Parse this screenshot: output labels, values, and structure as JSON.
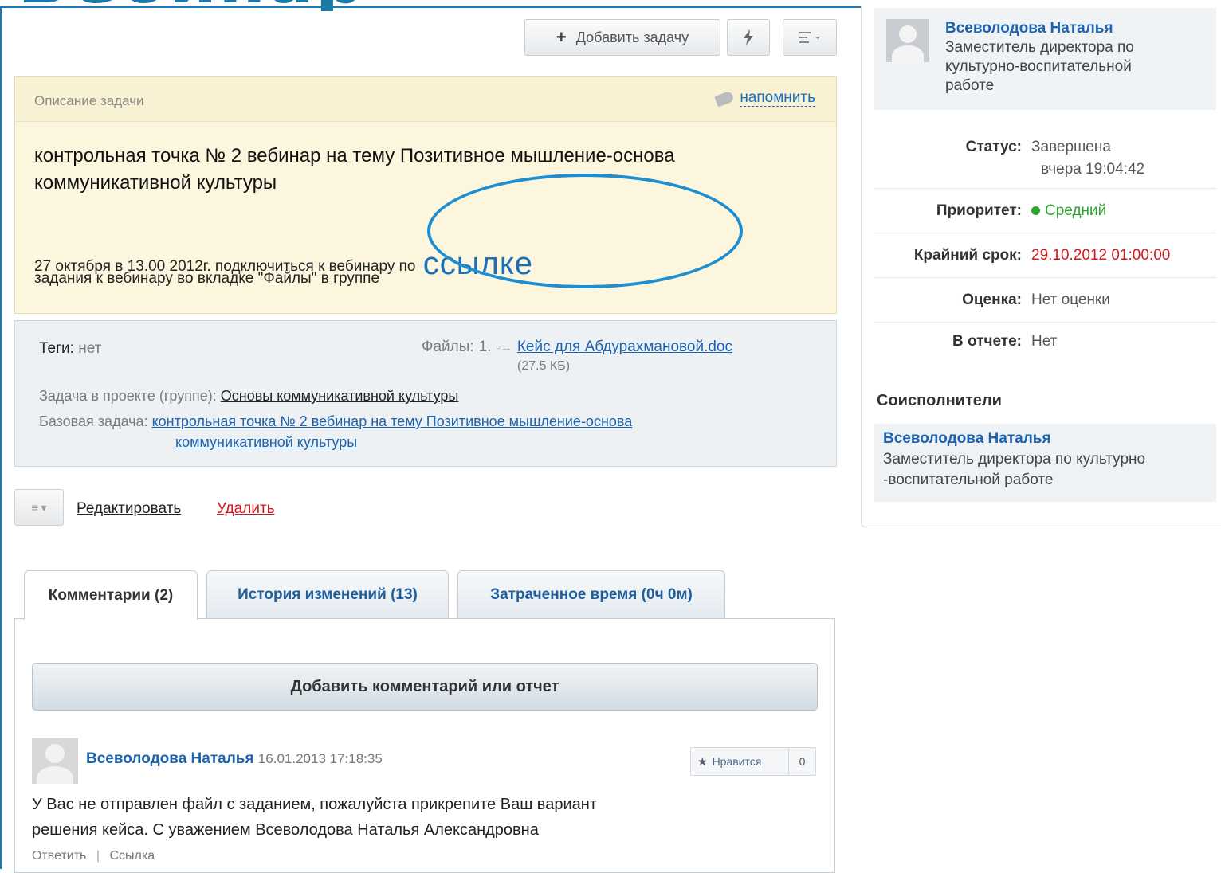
{
  "slide": {
    "title": "Вебинар"
  },
  "toolbar": {
    "add_task_label": "Добавить задачу",
    "add_task_icon": "plus-icon",
    "bolt_icon": "lightning-icon",
    "menu_icon": "list-menu-icon"
  },
  "description": {
    "label": "Описание задачи",
    "remind_label": "напомнить",
    "title": "контрольная точка № 2 вебинар на тему Позитивное мышление-основа коммуникативной культуры",
    "body_line1": "27 октября в 13.00 2012г. подключиться к вебинару по",
    "body_link": "ссылке",
    "body_line2": "задания к вебинару во вкладке \"Файлы\" в группе"
  },
  "meta": {
    "tags_label": "Теги:",
    "tags_value": "нет",
    "files_label": "Файлы:",
    "files_count": "1.",
    "file_name": "Кейс для Абдурахмановой.doc",
    "file_size": "(27.5 КБ)",
    "project_label": "Задача в проекте (группе):",
    "project_value": "Основы коммуникативной культуры",
    "base_task_label": "Базовая задача:",
    "base_task_line1": "контрольная точка № 2 вебинар на тему Позитивное мышление-основа",
    "base_task_line2": "коммуникативной культуры"
  },
  "actions": {
    "edit_label": "Редактировать",
    "delete_label": "Удалить"
  },
  "tabs": [
    {
      "label": "Комментарии (2)"
    },
    {
      "label": "История изменений (13)"
    },
    {
      "label": "Затраченное время (0ч 0м)"
    }
  ],
  "comments": {
    "add_label": "Добавить комментарий или отчет",
    "items": [
      {
        "author": "Всеволодова Наталья",
        "date": "16.01.2013 17:18:35",
        "like_label": "Нравится",
        "like_count": "0",
        "text_line1": "У Вас не отправлен файл с заданием, пожалуйста прикрепите Ваш вариант",
        "text_line2": "решения кейса. С уважением Всеволодова Наталья Александровна",
        "reply_label": "Ответить",
        "separator": "|",
        "link_label": "Ссылка"
      }
    ]
  },
  "sidebar": {
    "owner_name": "Всеволодова Наталья",
    "owner_role_line1": "Заместитель директора по",
    "owner_role_line2": "культурно-воспитательной",
    "owner_role_line3": "работе",
    "status_label": "Статус:",
    "status_value": "Завершена",
    "status_time": "вчера 19:04:42",
    "priority_label": "Приоритет:",
    "priority_value": "Средний",
    "priority_color": "#2fa52f",
    "deadline_label": "Крайний срок:",
    "deadline_value": "29.10.2012 01:00:00",
    "deadline_color": "#d0191c",
    "rating_label": "Оценка:",
    "rating_value": "Нет оценки",
    "report_label": "В отчете:",
    "report_value": "Нет",
    "coexec_header": "Соисполнители",
    "coexec_name": "Всеволодова Наталья",
    "coexec_role_line1": "Заместитель директора по культурно",
    "coexec_role_line2": "-воспитательной работе"
  }
}
